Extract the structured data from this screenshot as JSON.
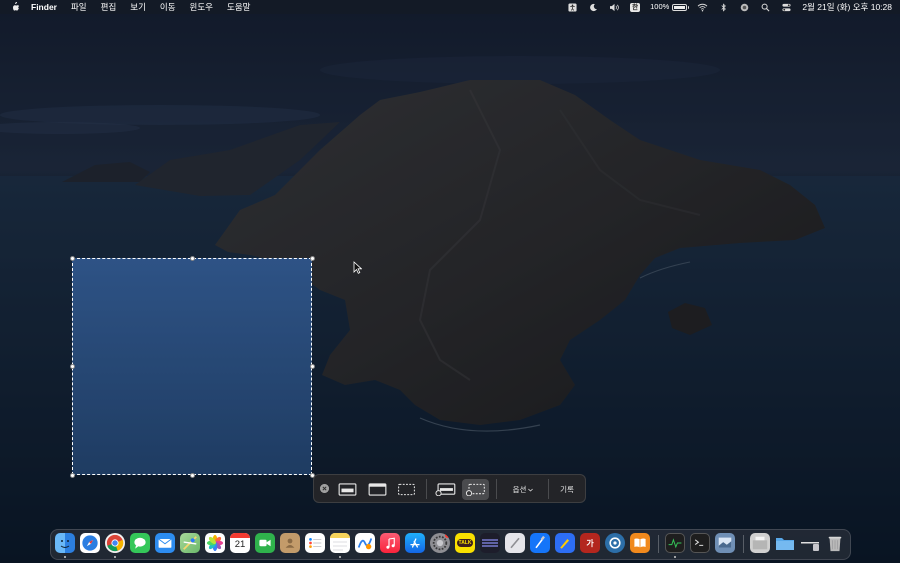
{
  "menubar": {
    "app_name": "Finder",
    "menus": [
      "파일",
      "편집",
      "보기",
      "이동",
      "윈도우",
      "도움말"
    ],
    "ime_label": "한",
    "battery_text": "100%",
    "clock": "2월 21일 (화) 오후 10:28"
  },
  "capture_toolbar": {
    "options_label": "옵션",
    "record_label": "기록"
  },
  "dock": {
    "apps": [
      {
        "name": "finder-icon",
        "color": "#3d8ef0"
      },
      {
        "name": "safari-icon",
        "color": "#2a7de1"
      },
      {
        "name": "chrome-icon",
        "color": "#ffffff"
      },
      {
        "name": "messages-icon",
        "color": "#34c759"
      },
      {
        "name": "mail-icon",
        "color": "#2d8cf0"
      },
      {
        "name": "maps-icon",
        "color": "#6bb86a"
      },
      {
        "name": "photos-icon",
        "color": "#ffffff"
      },
      {
        "name": "calendar-icon",
        "color": "#ffffff",
        "label": "21"
      },
      {
        "name": "facetime-icon",
        "color": "#2fb24c"
      },
      {
        "name": "contacts-icon",
        "color": "#c39b6a"
      },
      {
        "name": "reminders-icon",
        "color": "#ffffff"
      },
      {
        "name": "notes-icon",
        "color": "#f6d35a"
      },
      {
        "name": "freeform-icon",
        "color": "#ffffff"
      },
      {
        "name": "music-icon",
        "color": "#fa3b50"
      },
      {
        "name": "app-store-icon",
        "color": "#1c8df3"
      },
      {
        "name": "system-preferences-icon",
        "color": "#8e8e93"
      },
      {
        "name": "kakaotalk-icon",
        "color": "#f9e000",
        "label": "TALK"
      },
      {
        "name": "linear-icon",
        "color": "#5e5ce6"
      },
      {
        "name": "script-editor-icon",
        "color": "#e5e5ea"
      },
      {
        "name": "xcode-icon",
        "color": "#1575f9"
      },
      {
        "name": "pen-app-icon",
        "color": "#2d6ef5"
      },
      {
        "name": "dictionary-icon",
        "color": "#b3261e",
        "label": "가"
      },
      {
        "name": "proxyman-icon",
        "color": "#2c6ea8"
      },
      {
        "name": "books-icon",
        "color": "#f0891d"
      },
      {
        "name": "activity-monitor-icon",
        "color": "#1e1e1e"
      },
      {
        "name": "terminal-icon",
        "color": "#1e1e1e"
      },
      {
        "name": "preview-icon",
        "color": "#6f8fb5"
      },
      {
        "name": "downloads-stack-icon",
        "color": "#d0d0d0"
      },
      {
        "name": "folder-stack-icon",
        "color": "#58a7e8"
      },
      {
        "name": "documents-stack-icon",
        "color": "#e0e0e0"
      },
      {
        "name": "trash-icon",
        "color": "#b9b9b9"
      }
    ]
  }
}
